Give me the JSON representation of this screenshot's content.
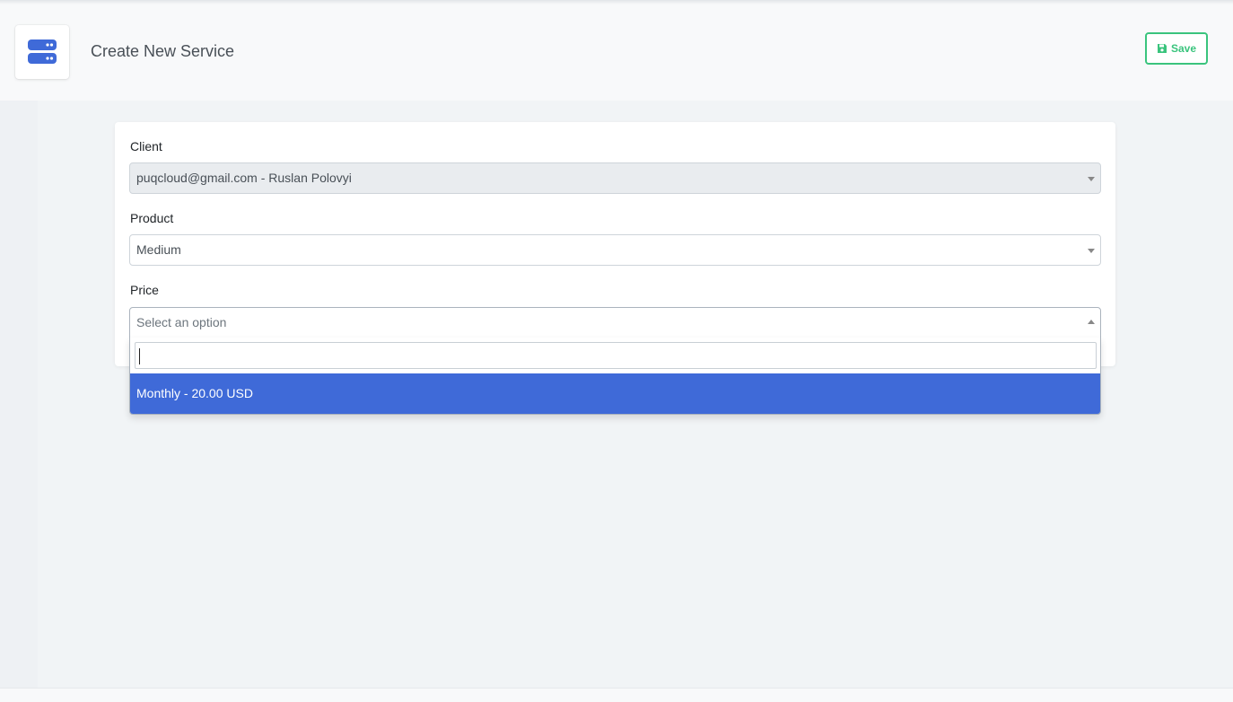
{
  "header": {
    "title": "Create New Service",
    "icon": "server-icon",
    "save_label": "Save",
    "save_icon": "floppy-disk-icon"
  },
  "colors": {
    "accent": "#3f6ad8",
    "success": "#3ac47d",
    "page_bg": "#f1f4f6"
  },
  "form": {
    "client": {
      "label": "Client",
      "value": "puqcloud@gmail.com - Ruslan Polovyi",
      "disabled": true
    },
    "product": {
      "label": "Product",
      "value": "Medium"
    },
    "price": {
      "label": "Price",
      "placeholder": "Select an option",
      "open": true,
      "search_value": "",
      "options": [
        "Monthly - 20.00 USD"
      ],
      "highlighted_option": "Monthly - 20.00 USD"
    }
  }
}
